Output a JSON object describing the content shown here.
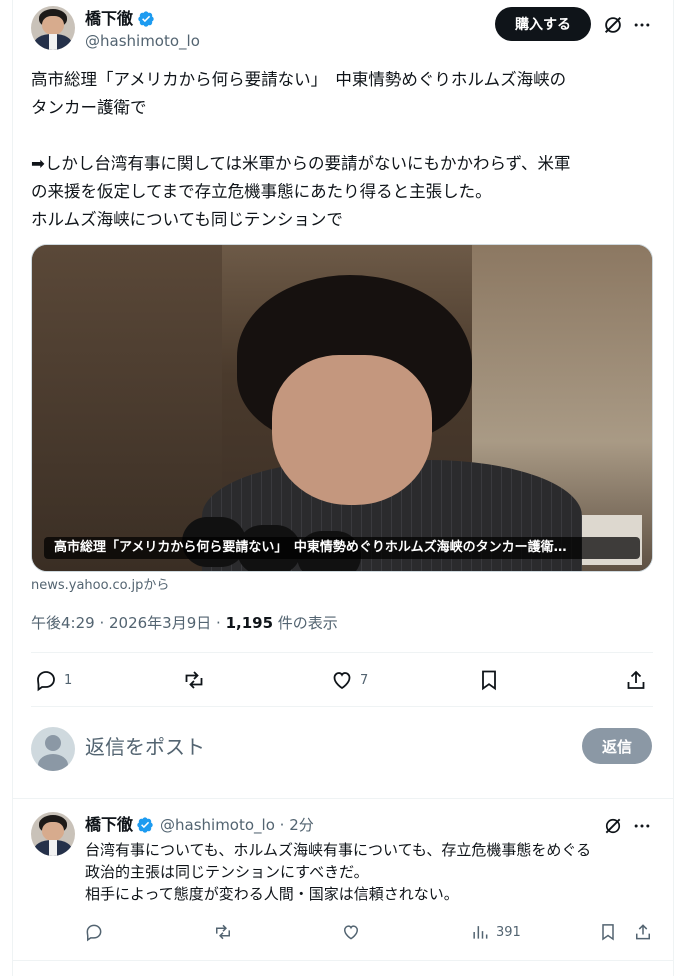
{
  "post": {
    "author": {
      "name": "橋下徹",
      "handle": "@hashimoto_lo"
    },
    "buy_label": "購入する",
    "text": "高市総理「アメリカから何ら要請ない」　中東情勢めぐりホルムズ海峡の\nタンカー護衛で\n\n➡しかし台湾有事に関しては米軍からの要請がないにもかかわらず、米軍\nの来援を仮定してまで存立危機事態にあたり得ると主張した。\nホルムズ海峡についても同じテンションで",
    "media_caption": "高市総理「アメリカから何ら要請ない」　中東情勢めぐりホルムズ海峡のタンカー護衛…",
    "source": "news.yahoo.co.jpから",
    "meta": {
      "time": "午後4:29 · 2026年3月9日 · ",
      "views": "1,195",
      "views_suffix": " 件の表示"
    },
    "actions": {
      "replies": "1",
      "likes": "7"
    }
  },
  "reply_box": {
    "placeholder": "返信をポスト",
    "button_label": "返信"
  },
  "reply": {
    "author": {
      "name": "橋下徹",
      "handle": "@hashimoto_lo",
      "time": " · 2分"
    },
    "text": "台湾有事についても、ホルムズ海峡有事についても、存立危機事態をめぐる\n政治的主張は同じテンションにすべきだ。\n相手によって態度が変わる人間・国家は信頼されない。",
    "views": "391"
  },
  "icons": {
    "verified": "verified-badge-icon",
    "grok": "grok-icon",
    "more": "more-icon",
    "reply": "reply-icon",
    "repost": "repost-icon",
    "like": "like-icon",
    "bookmark": "bookmark-icon",
    "share": "share-icon",
    "views": "views-icon"
  },
  "colors": {
    "verified": "#1d9bf0",
    "text": "#0f1419",
    "secondary": "#536471",
    "disabled_button": "#8b98a5"
  }
}
